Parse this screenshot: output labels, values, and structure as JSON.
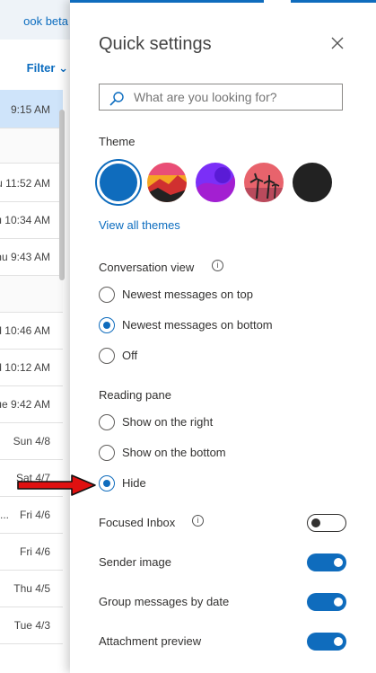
{
  "mail_list": {
    "app_label": "ook beta",
    "filter_label": "Filter",
    "times": [
      "9:15 AM",
      "u 11:52 AM",
      "u 10:34 AM",
      "hu 9:43 AM",
      "d 10:46 AM",
      "d 10:12 AM",
      "ue 9:42 AM",
      "Sun 4/8",
      "Sat 4/7",
      "Fri 4/6",
      "Fri 4/6",
      "Thu 4/5",
      "Tue 4/3"
    ],
    "partial_sender": "..."
  },
  "panel": {
    "title": "Quick settings",
    "search_placeholder": "What are you looking for?",
    "theme": {
      "heading": "Theme",
      "view_all": "View all themes"
    },
    "conversation_view": {
      "heading": "Conversation view",
      "options": [
        "Newest messages on top",
        "Newest messages on bottom",
        "Off"
      ],
      "selected": "Newest messages on bottom"
    },
    "reading_pane": {
      "heading": "Reading pane",
      "options": [
        "Show on the right",
        "Show on the bottom",
        "Hide"
      ],
      "selected": "Hide"
    },
    "toggles": [
      {
        "label": "Focused Inbox",
        "on": false
      },
      {
        "label": "Sender image",
        "on": true
      },
      {
        "label": "Group messages by date",
        "on": true
      },
      {
        "label": "Attachment preview",
        "on": true
      }
    ]
  },
  "colors": {
    "accent": "#0f6cbd",
    "annotation_arrow": "#e01010"
  }
}
